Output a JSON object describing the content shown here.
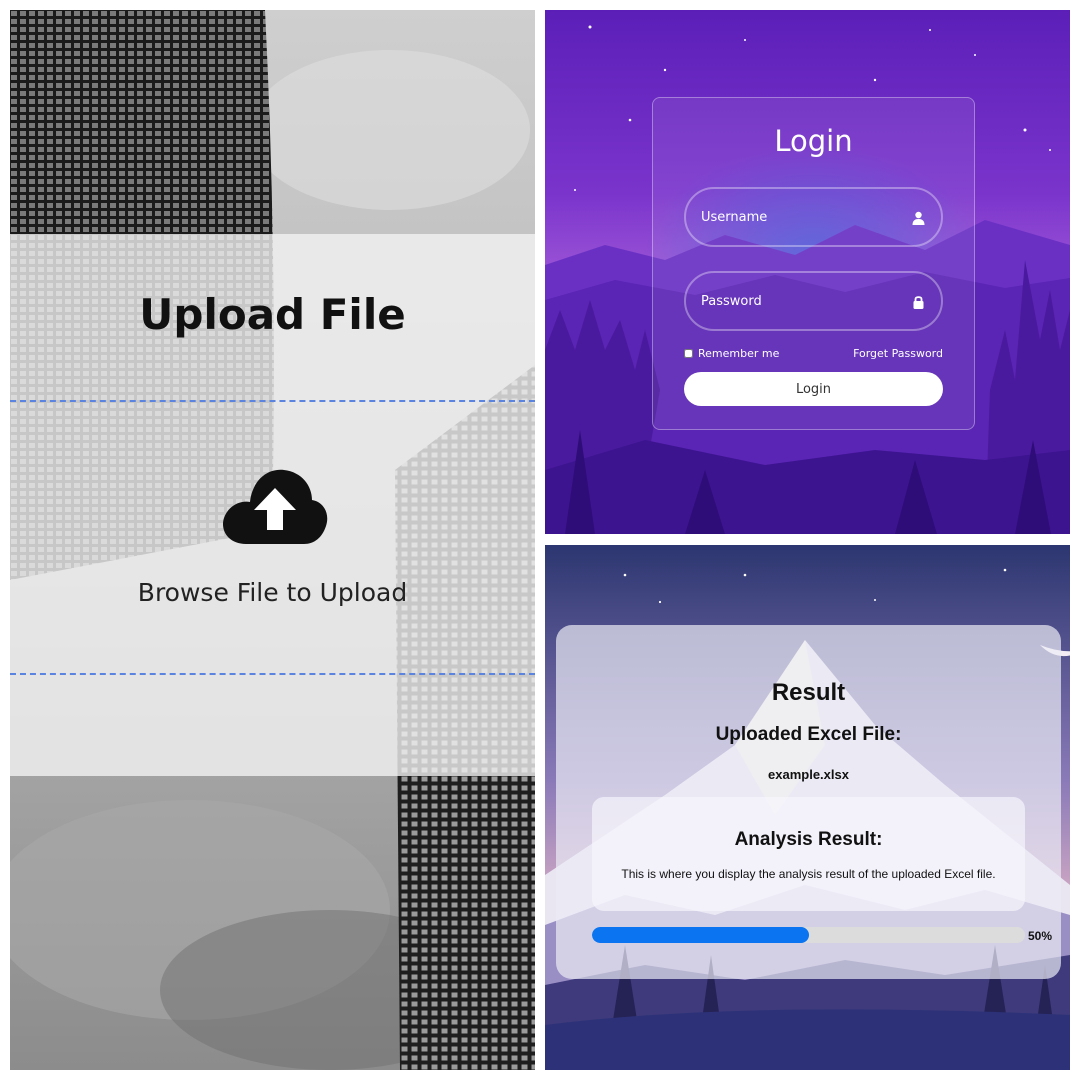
{
  "upload": {
    "title": "Upload File",
    "browse_text": "Browse File to Upload",
    "icon": "cloud-upload-icon",
    "dash_color": "#5b84e0"
  },
  "login": {
    "title": "Login",
    "username_placeholder": "Username",
    "password_placeholder": "Password",
    "remember_label": "Remember me",
    "forgot_label": "Forget Password",
    "button_label": "Login",
    "icons": {
      "username": "user-icon",
      "password": "lock-icon"
    },
    "accent": "#6b2bd0"
  },
  "result": {
    "title": "Result",
    "uploaded_heading": "Uploaded Excel File:",
    "file_name": "example.xlsx",
    "analysis_heading": "Analysis Result:",
    "analysis_text": "This is where you display the analysis result of the uploaded Excel file.",
    "progress_percent": 50,
    "progress_label": "50%",
    "progress_color": "#0b74f0"
  }
}
